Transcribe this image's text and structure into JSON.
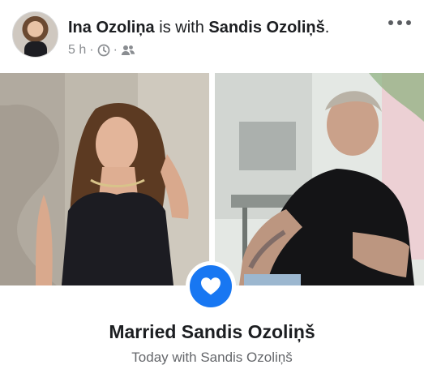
{
  "post": {
    "author": "Ina Ozoliņa",
    "connector": " is with ",
    "tagged": "Sandis Ozoliņš",
    "headline_end": ".",
    "time": "5 h",
    "separator": "·",
    "privacy_icon": "friends-icon",
    "clock_icon": "clock-icon"
  },
  "life_event": {
    "title": "Married Sandis Ozoliņš",
    "subtitle": "Today with Sandis Ozoliņš",
    "icon": "heart-icon",
    "badge_color": "#1877f2"
  },
  "colors": {
    "text": "#1c1e21",
    "muted": "#8a8d91",
    "accent": "#1877f2"
  }
}
